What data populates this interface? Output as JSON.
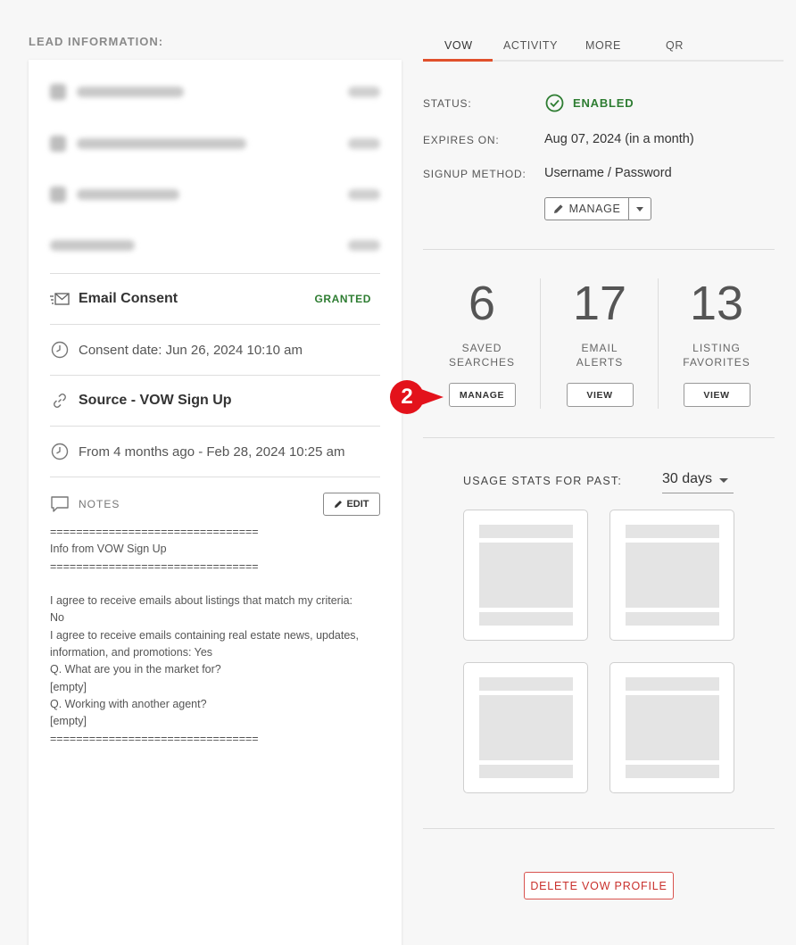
{
  "lead": {
    "heading": "LEAD INFORMATION:",
    "consent": {
      "title": "Email Consent",
      "status": "GRANTED",
      "date": "Consent date: Jun 26, 2024 10:10 am"
    },
    "source": {
      "title": "Source - VOW Sign Up",
      "date": "From 4 months ago - Feb 28, 2024 10:25 am"
    },
    "notes": {
      "label": "NOTES",
      "edit_label": "EDIT",
      "lines": [
        "================================",
        "Info from VOW Sign Up",
        "================================",
        "",
        "I agree to receive emails about listings that match my criteria:",
        "No",
        "I agree to receive emails containing real estate news, updates,",
        "information, and promotions: Yes",
        "Q. What are you in the market for?",
        "[empty]",
        "Q. Working with another agent?",
        "[empty]",
        "================================"
      ]
    }
  },
  "tabs": [
    "VOW",
    "ACTIVITY",
    "MORE",
    "QR"
  ],
  "vow": {
    "status_label": "STATUS:",
    "status_value": "ENABLED",
    "expires_label": "EXPIRES ON:",
    "expires_value": "Aug 07, 2024 (in a month)",
    "signup_label": "SIGNUP METHOD:",
    "signup_value": "Username / Password",
    "manage_label": "MANAGE"
  },
  "stats": [
    {
      "number": "6",
      "label_line1": "SAVED",
      "label_line2": "SEARCHES",
      "button": "MANAGE"
    },
    {
      "number": "17",
      "label_line1": "EMAIL",
      "label_line2": "ALERTS",
      "button": "VIEW"
    },
    {
      "number": "13",
      "label_line1": "LISTING",
      "label_line2": "FAVORITES",
      "button": "VIEW"
    }
  ],
  "annotation": {
    "step": "2"
  },
  "usage": {
    "label": "USAGE STATS FOR PAST:",
    "period": "30 days"
  },
  "delete_label": "DELETE VOW PROFILE",
  "colors": {
    "accent": "#e0502b",
    "success": "#2e7d32",
    "danger": "#c9302c",
    "annotation": "#e3121b"
  }
}
